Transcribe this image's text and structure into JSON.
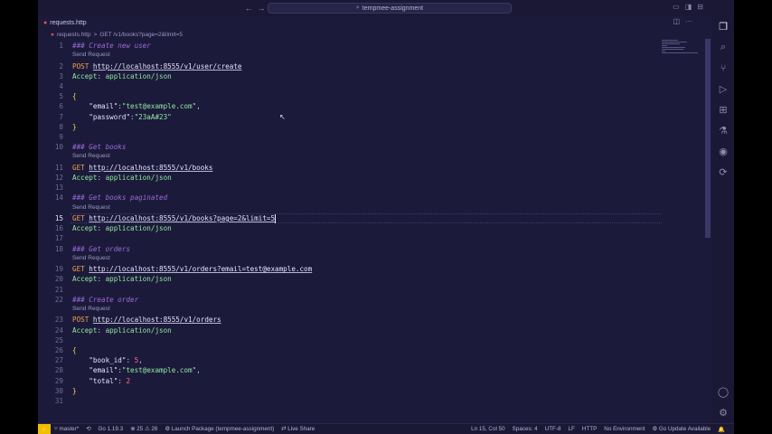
{
  "titlebar": {
    "back": "←",
    "forward": "→",
    "search_icon": "⌕",
    "title": "tempmee-assignment"
  },
  "tab": {
    "label": "requests.http",
    "modified_dot": "●"
  },
  "breadcrumb": {
    "file": "requests.http",
    "sep": ">",
    "item": "GET /v1/books?page=2&limit=5"
  },
  "editor": {
    "code_lens": "Send Request",
    "cursor_line": 15,
    "lines": [
      {
        "n": "1",
        "t": "comment",
        "text": "### Create new user"
      },
      {
        "n": "2",
        "t": "request",
        "method": "POST",
        "url": "http://localhost:8555/v1/user/create"
      },
      {
        "n": "3",
        "t": "header",
        "name": "Accept",
        "value": "application/json"
      },
      {
        "n": "4",
        "t": "blank"
      },
      {
        "n": "5",
        "t": "brace",
        "text": "{"
      },
      {
        "n": "6",
        "t": "pair",
        "key": "\"email\"",
        "value": "\"test@example.com\"",
        "vt": "str",
        "comma": ","
      },
      {
        "n": "7",
        "t": "pair",
        "key": "\"password\"",
        "value": "\"23aA#23\"",
        "vt": "str",
        "comma": ""
      },
      {
        "n": "8",
        "t": "brace",
        "text": "}"
      },
      {
        "n": "9",
        "t": "blank"
      },
      {
        "n": "10",
        "t": "comment",
        "text": "### Get books"
      },
      {
        "n": "11",
        "t": "request",
        "method": "GET",
        "url": "http://localhost:8555/v1/books"
      },
      {
        "n": "12",
        "t": "header",
        "name": "Accept",
        "value": "application/json"
      },
      {
        "n": "13",
        "t": "blank"
      },
      {
        "n": "14",
        "t": "comment",
        "text": "### Get books paginated"
      },
      {
        "n": "15",
        "t": "request",
        "method": "GET",
        "url": "http://localhost:8555/v1/books?page=2&limit=5"
      },
      {
        "n": "16",
        "t": "header",
        "name": "Accept",
        "value": "application/json"
      },
      {
        "n": "17",
        "t": "blank"
      },
      {
        "n": "18",
        "t": "comment",
        "text": "### Get orders"
      },
      {
        "n": "19",
        "t": "request",
        "method": "GET",
        "url": "http://localhost:8555/v1/orders?email=test@example.com"
      },
      {
        "n": "20",
        "t": "header",
        "name": "Accept",
        "value": "application/json"
      },
      {
        "n": "21",
        "t": "blank"
      },
      {
        "n": "22",
        "t": "comment",
        "text": "### Create order"
      },
      {
        "n": "23",
        "t": "request",
        "method": "POST",
        "url": "http://localhost:8555/v1/orders"
      },
      {
        "n": "24",
        "t": "header",
        "name": "Accept",
        "value": "application/json"
      },
      {
        "n": "25",
        "t": "blank"
      },
      {
        "n": "26",
        "t": "brace",
        "text": "{"
      },
      {
        "n": "27",
        "t": "pair",
        "key": "\"book_id\"",
        "value": "5",
        "vt": "num",
        "comma": ","
      },
      {
        "n": "28",
        "t": "pair",
        "key": "\"email\"",
        "value": "\"test@example.com\"",
        "vt": "str",
        "comma": ","
      },
      {
        "n": "29",
        "t": "pair",
        "key": "\"total\"",
        "value": "2",
        "vt": "num",
        "comma": ""
      },
      {
        "n": "30",
        "t": "brace",
        "text": "}"
      },
      {
        "n": "31",
        "t": "blank"
      }
    ]
  },
  "activity_bar": [
    {
      "name": "explorer-icon",
      "glyph": "❐"
    },
    {
      "name": "search-icon",
      "glyph": "⌕"
    },
    {
      "name": "source-control-icon",
      "glyph": "⑂"
    },
    {
      "name": "run-debug-icon",
      "glyph": "▷"
    },
    {
      "name": "extensions-icon",
      "glyph": "⊞"
    },
    {
      "name": "testing-icon",
      "glyph": "⚗"
    },
    {
      "name": "github-icon",
      "glyph": "◉"
    },
    {
      "name": "remote-icon",
      "glyph": "⟳"
    }
  ],
  "activity_bottom": [
    {
      "name": "account-icon",
      "glyph": "◯"
    },
    {
      "name": "settings-gear-icon",
      "glyph": "⚙"
    }
  ],
  "statusbar": {
    "remote": "⚡",
    "branch": "⑂ master*",
    "sync": "⟲",
    "go": "Go 1.19.3",
    "problems": "⊗ 25 ⚠ 26",
    "launch": "⚙ Launch Package (tempmee-assignment)",
    "liveshare": "⇄ Live Share",
    "position": "Ln 15, Col 50",
    "spaces": "Spaces: 4",
    "encoding": "UTF-8",
    "eol": "LF",
    "language": "HTTP",
    "environment": "No Environment",
    "update": "⚙ Go Update Available",
    "notifications": "🔔"
  }
}
